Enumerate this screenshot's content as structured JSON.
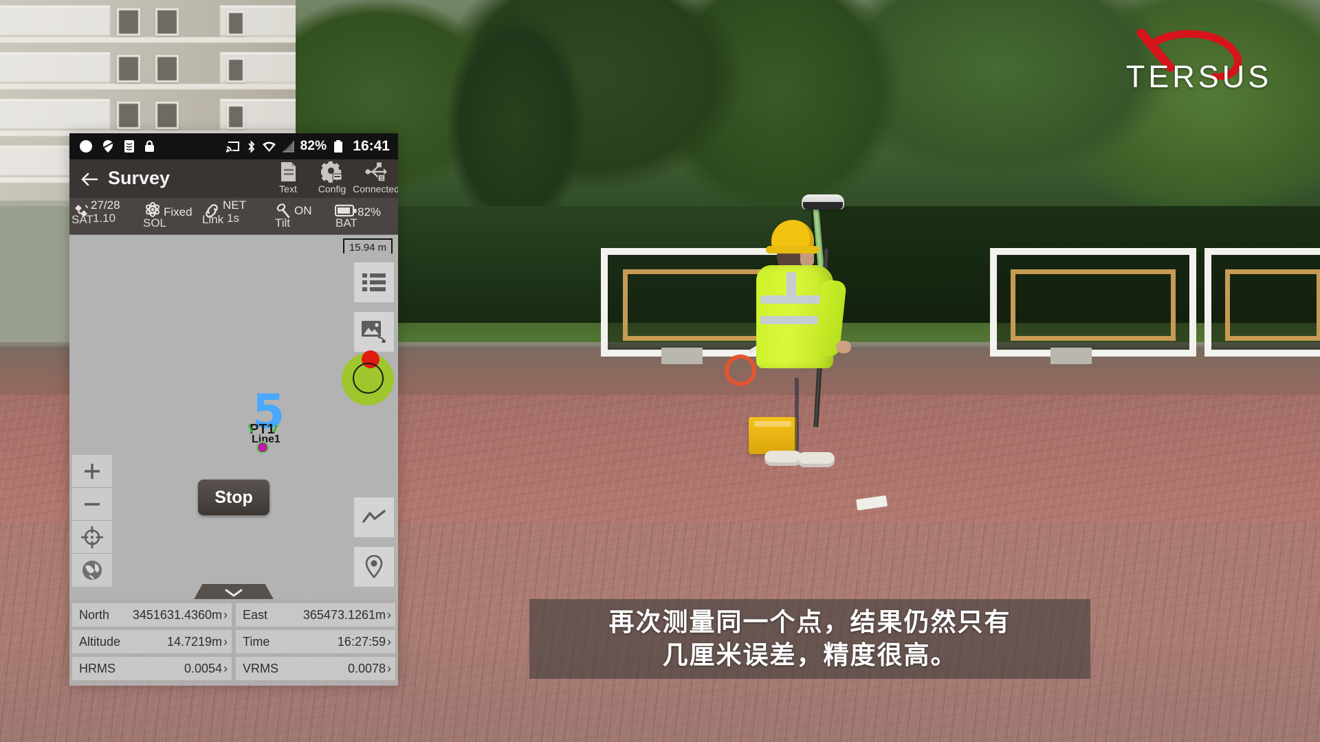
{
  "branding": {
    "logo_text": "TERSUS",
    "logo_color": "#d7141a"
  },
  "subtitle": {
    "line1": "再次测量同一个点，结果仍然只有",
    "line2": "几厘米误差，精度很高。"
  },
  "phone": {
    "statusbar": {
      "icons_left": [
        "circle-icon",
        "balloon-icon",
        "fingerprint-icon",
        "lock-icon"
      ],
      "icons_right": [
        "cast-icon",
        "bluetooth-icon",
        "wifi-icon",
        "signal-icon"
      ],
      "battery_percent": "82%",
      "battery_icon": "battery-icon",
      "time": "16:41"
    },
    "titlebar": {
      "back_icon": "back-arrow-icon",
      "title": "Survey",
      "actions": [
        {
          "label": "Text",
          "icon": "document-icon"
        },
        {
          "label": "Config",
          "icon": "gear-icon"
        },
        {
          "label": "Connected",
          "icon": "usb-connected-icon"
        }
      ]
    },
    "status_strip": [
      {
        "icon": "satellite-icon",
        "value": "27/28",
        "sub": "1.10",
        "label": "SAT"
      },
      {
        "icon": "atom-icon",
        "value": "Fixed",
        "sub": "",
        "label": "SOL"
      },
      {
        "icon": "link-icon",
        "value": "NET",
        "sub": "1s",
        "label": "Link"
      },
      {
        "icon": "tilt-icon",
        "value": "ON",
        "sub": "",
        "label": "Tilt"
      },
      {
        "icon": "battery-icon",
        "value": "82%",
        "sub": "",
        "label": "BAT"
      }
    ],
    "map": {
      "scale": "15.94 m",
      "point": {
        "number": "5",
        "code": "PT1",
        "line": "Line1"
      },
      "stop_button": "Stop",
      "right_tools": [
        {
          "name": "list-icon"
        },
        {
          "name": "layers-image-icon"
        }
      ],
      "record_button": {
        "name": "record-point-button",
        "fill": "#9fc62a",
        "dot": "#e01b10"
      },
      "bottom_tools": [
        {
          "name": "chart-line-icon"
        },
        {
          "name": "location-pin-icon"
        }
      ],
      "left_tools": [
        {
          "name": "zoom-in-icon"
        },
        {
          "name": "zoom-out-icon"
        },
        {
          "name": "crosshair-target-icon"
        },
        {
          "name": "globe-icon"
        }
      ],
      "expander_icon": "chevron-down-icon"
    },
    "data_panel": {
      "chevron": "›",
      "rows": [
        [
          {
            "label": "North",
            "value": "3451631.4360m"
          },
          {
            "label": "East",
            "value": "365473.1261m"
          }
        ],
        [
          {
            "label": "Altitude",
            "value": "14.7219m"
          },
          {
            "label": "Time",
            "value": "16:27:59"
          }
        ],
        [
          {
            "label": "HRMS",
            "value": "0.0054"
          },
          {
            "label": "VRMS",
            "value": "0.0078"
          }
        ]
      ]
    }
  }
}
